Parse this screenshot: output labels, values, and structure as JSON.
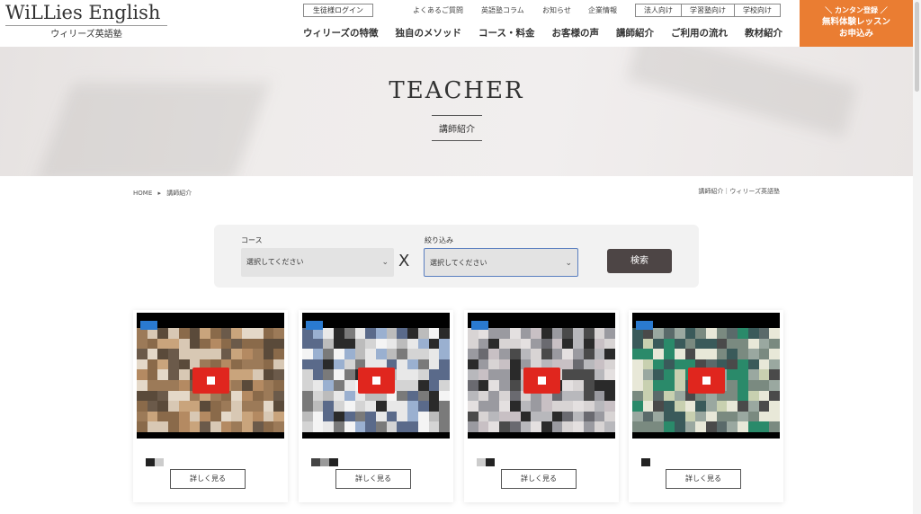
{
  "header": {
    "logo_en": "WiLLies English",
    "logo_jp": "ウィリーズ英語塾",
    "login": "生徒様ログイン",
    "sub_links": [
      "よくあるご質問",
      "英語塾コラム",
      "お知らせ",
      "企業情報"
    ],
    "segments": [
      "法人向け",
      "学習塾向け",
      "学校向け"
    ],
    "nav": [
      "ウィリーズの特徴",
      "独自のメソッド",
      "コース・料金",
      "お客様の声",
      "講師紹介",
      "ご利用の流れ",
      "教材紹介"
    ],
    "cta": {
      "line1": "＼ カンタン登録 ／",
      "line2": "無料体験レッスン",
      "line3": "お申込み",
      "color": "#ea7d32"
    }
  },
  "hero": {
    "title": "TEACHER",
    "subtitle": "講師紹介"
  },
  "breadcrumb": {
    "home": "HOME",
    "separator": "▸",
    "current": "講師紹介",
    "right": "講師紹介｜ウィリーズ英語塾"
  },
  "search": {
    "course_label": "コース",
    "course_value": "選択してください",
    "filter_label": "絞り込み",
    "filter_value": "選択してください",
    "times": "X",
    "button": "検索"
  },
  "cards": [
    {
      "more": "詳しく見る"
    },
    {
      "more": "詳しく見る"
    },
    {
      "more": "詳しく見る"
    },
    {
      "more": "詳しく見る"
    }
  ]
}
